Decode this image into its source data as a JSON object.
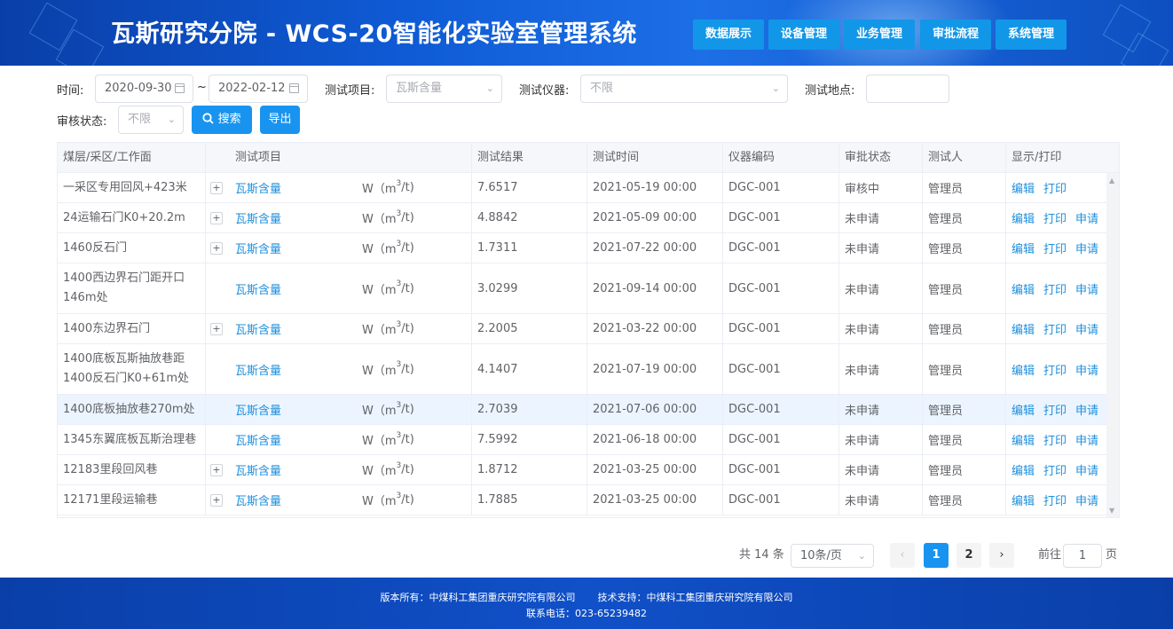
{
  "header": {
    "title": "瓦斯研究分院 - WCS-20智能化实验室管理系统",
    "nav": [
      "数据展示",
      "设备管理",
      "业务管理",
      "审批流程",
      "系统管理"
    ]
  },
  "filters": {
    "time_label": "时间:",
    "start_date": "2020-09-30",
    "separator": "~",
    "end_date": "2022-02-12",
    "item_label": "测试项目:",
    "item_value": "瓦斯含量",
    "instrument_label": "测试仪器:",
    "instrument_placeholder": "不限",
    "location_label": "测试地点:",
    "location_value": "",
    "audit_label": "审核状态:",
    "audit_placeholder": "不限",
    "search_label": "搜索",
    "export_label": "导出"
  },
  "table": {
    "columns": [
      "煤层/采区/工作面",
      "测试项目",
      "测试结果",
      "测试时间",
      "仪器编码",
      "审批状态",
      "测试人",
      "显示/打印"
    ],
    "unit_prefix": "W（m",
    "unit_sup": "3",
    "unit_suffix": "/t)",
    "rows": [
      {
        "location": "一采区专用回风+423米",
        "item": "瓦斯含量",
        "result": "7.6517",
        "time": "2021-05-19 00:00",
        "code": "DGC-001",
        "status": "审核中",
        "tester": "管理员",
        "actions": [
          "编辑",
          "打印"
        ],
        "expand": "+"
      },
      {
        "location": "24运输石门K0+20.2m",
        "item": "瓦斯含量",
        "result": "4.8842",
        "time": "2021-05-09 00:00",
        "code": "DGC-001",
        "status": "未申请",
        "tester": "管理员",
        "actions": [
          "编辑",
          "打印",
          "申请"
        ],
        "expand": "+"
      },
      {
        "location": "1460反石门",
        "item": "瓦斯含量",
        "result": "1.7311",
        "time": "2021-07-22 00:00",
        "code": "DGC-001",
        "status": "未申请",
        "tester": "管理员",
        "actions": [
          "编辑",
          "打印",
          "申请"
        ],
        "expand": "+"
      },
      {
        "location": "1400西边界石门距开口146m处",
        "item": "瓦斯含量",
        "result": "3.0299",
        "time": "2021-09-14 00:00",
        "code": "DGC-001",
        "status": "未申请",
        "tester": "管理员",
        "actions": [
          "编辑",
          "打印",
          "申请"
        ],
        "expand": ""
      },
      {
        "location": "1400东边界石门",
        "item": "瓦斯含量",
        "result": "2.2005",
        "time": "2021-03-22 00:00",
        "code": "DGC-001",
        "status": "未申请",
        "tester": "管理员",
        "actions": [
          "编辑",
          "打印",
          "申请"
        ],
        "expand": "+"
      },
      {
        "location": "1400底板瓦斯抽放巷距1400反石门K0+61m处",
        "item": "瓦斯含量",
        "result": "4.1407",
        "time": "2021-07-19 00:00",
        "code": "DGC-001",
        "status": "未申请",
        "tester": "管理员",
        "actions": [
          "编辑",
          "打印",
          "申请"
        ],
        "expand": ""
      },
      {
        "location": "1400底板抽放巷270m处",
        "item": "瓦斯含量",
        "result": "2.7039",
        "time": "2021-07-06 00:00",
        "code": "DGC-001",
        "status": "未申请",
        "tester": "管理员",
        "actions": [
          "编辑",
          "打印",
          "申请"
        ],
        "expand": ""
      },
      {
        "location": "1345东翼底板瓦斯治理巷",
        "item": "瓦斯含量",
        "result": "7.5992",
        "time": "2021-06-18 00:00",
        "code": "DGC-001",
        "status": "未申请",
        "tester": "管理员",
        "actions": [
          "编辑",
          "打印",
          "申请"
        ],
        "expand": ""
      },
      {
        "location": "12183里段回风巷",
        "item": "瓦斯含量",
        "result": "1.8712",
        "time": "2021-03-25 00:00",
        "code": "DGC-001",
        "status": "未申请",
        "tester": "管理员",
        "actions": [
          "编辑",
          "打印",
          "申请"
        ],
        "expand": "+"
      },
      {
        "location": "12171里段运输巷",
        "item": "瓦斯含量",
        "result": "1.7885",
        "time": "2021-03-25 00:00",
        "code": "DGC-001",
        "status": "未申请",
        "tester": "管理员",
        "actions": [
          "编辑",
          "打印",
          "申请"
        ],
        "expand": "+"
      }
    ]
  },
  "pagination": {
    "total": "共 14 条",
    "page_size": "10条/页",
    "prev": "‹",
    "pages": [
      "1",
      "2"
    ],
    "next": "›",
    "goto_label": "前往",
    "goto_value": "1",
    "goto_suffix": "页"
  },
  "footer": {
    "copyright": "版本所有：中煤科工集团重庆研究院有限公司",
    "support": "技术支持：中煤科工集团重庆研究院有限公司",
    "phone": "联系电话：023-65239482"
  }
}
